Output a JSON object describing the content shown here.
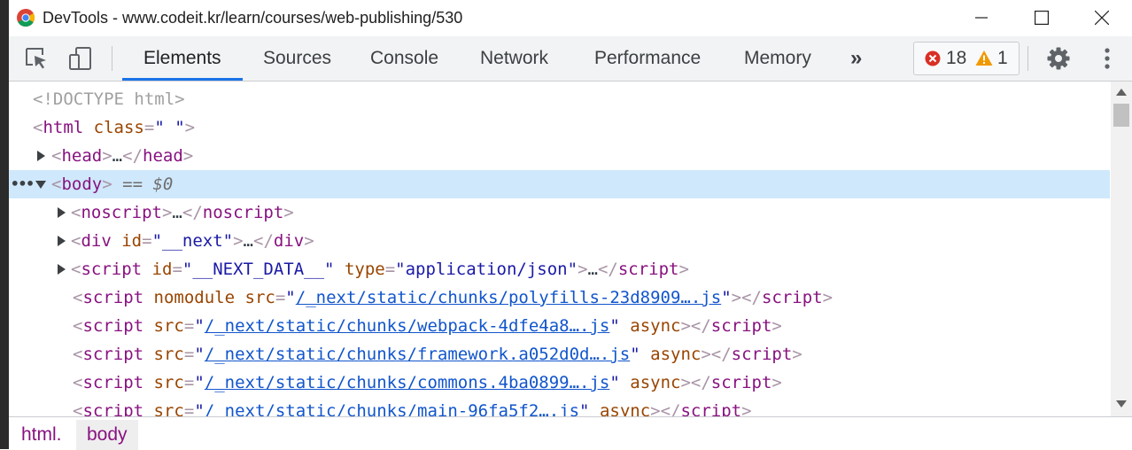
{
  "window": {
    "title": "DevTools - www.codeit.kr/learn/courses/web-publishing/530",
    "controls": [
      "minimize",
      "maximize",
      "close"
    ]
  },
  "toolbar": {
    "icons": [
      "inspect-element-icon",
      "device-toolbar-icon"
    ],
    "tabs": [
      {
        "label": "Elements",
        "active": true
      },
      {
        "label": "Sources"
      },
      {
        "label": "Console"
      },
      {
        "label": "Network"
      },
      {
        "label": "Performance"
      },
      {
        "label": "Memory"
      }
    ],
    "more_tabs": "»",
    "errors": "18",
    "warnings": "1",
    "accent_color": "#1a73e8"
  },
  "tree": {
    "doctype": "<!DOCTYPE html>",
    "html_tag": "html",
    "html_attr": "class",
    "html_attr_val": "\" \"",
    "head": "head",
    "ellipsis": "…",
    "body": "body",
    "body_marker": "== $0",
    "noscript": "noscript",
    "div": "div",
    "div_attr": "id",
    "div_val": "\"__next\"",
    "script": "script",
    "nd_attr": "id",
    "nd_val": "\"__NEXT_DATA__\"",
    "nd_type_attr": "type",
    "nd_type_val": "\"application/json\"",
    "s1_attr_nomodule": "nomodule",
    "src": "src",
    "async": "async",
    "s1_src": "/_next/static/chunks/polyfills-23d8909….js",
    "s2_src": "/_next/static/chunks/webpack-4dfe4a8….js",
    "s3_src": "/_next/static/chunks/framework.a052d0d….js",
    "s4_src": "/_next/static/chunks/commons.4ba0899….js",
    "s5_src": "/_next/static/chunks/main-96fa5f2….js"
  },
  "breadcrumbs": [
    "html.",
    "body"
  ]
}
